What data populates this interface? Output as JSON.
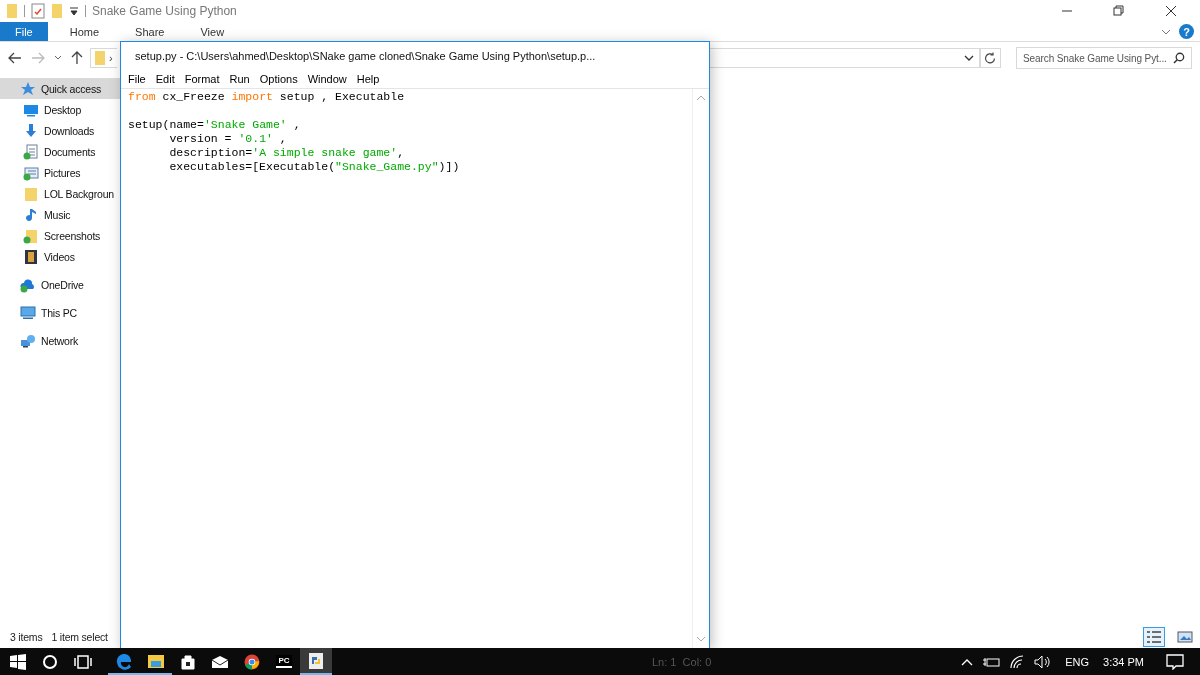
{
  "explorer": {
    "title": "Snake Game Using Python",
    "ribbon_tabs": [
      {
        "label": "File",
        "selected": true
      },
      {
        "label": "Home",
        "selected": false
      },
      {
        "label": "Share",
        "selected": false
      },
      {
        "label": "View",
        "selected": false
      }
    ],
    "help": "?",
    "address_chevron": "›",
    "search": {
      "placeholder": "Search Snake Game Using Pyt..."
    },
    "nav_items": [
      {
        "label": "Quick access",
        "kind": "star",
        "selected": true,
        "children": [
          {
            "label": "Desktop",
            "kind": "desktop",
            "selected": false
          },
          {
            "label": "Downloads",
            "kind": "download",
            "selected": false
          },
          {
            "label": "Documents",
            "kind": "documents",
            "selected": false
          },
          {
            "label": "Pictures",
            "kind": "pictures",
            "selected": false
          },
          {
            "label": "LOL Backgroun",
            "kind": "folder",
            "selected": false
          },
          {
            "label": "Music",
            "kind": "music",
            "selected": false
          },
          {
            "label": "Screenshots",
            "kind": "folder-check",
            "selected": false
          },
          {
            "label": "Videos",
            "kind": "videos",
            "selected": false
          }
        ]
      },
      {
        "label": "OneDrive",
        "kind": "cloud",
        "selected": false
      },
      {
        "label": "This PC",
        "kind": "pc",
        "selected": false
      },
      {
        "label": "Network",
        "kind": "network",
        "selected": false
      }
    ],
    "status": [
      "3 items",
      "1 item select"
    ],
    "views": [
      {
        "kind": "details",
        "selected": true
      },
      {
        "kind": "large",
        "selected": false
      }
    ]
  },
  "editor": {
    "title": "setup.py - C:\\Users\\ahmed\\Desktop\\SNake game cloned\\Snake Game Using Python\\setup.p...",
    "menu": [
      "File",
      "Edit",
      "Format",
      "Run",
      "Options",
      "Window",
      "Help"
    ],
    "lines": [
      {
        "tokens": [
          {
            "kind": "keyword",
            "text": "from"
          },
          {
            "kind": "plain",
            "text": " cx_Freeze "
          },
          {
            "kind": "keyword",
            "text": "import"
          },
          {
            "kind": "plain",
            "text": " setup , Executable"
          }
        ]
      },
      {
        "kind": "blank"
      },
      {
        "tokens": [
          {
            "kind": "plain",
            "text": "setup(name="
          },
          {
            "kind": "string",
            "text": "'Snake Game'"
          },
          {
            "kind": "plain",
            "text": " ,"
          }
        ]
      },
      {
        "tokens": [
          {
            "kind": "plain",
            "text": "      version = "
          },
          {
            "kind": "string",
            "text": "'0.1'"
          },
          {
            "kind": "plain",
            "text": " ,"
          }
        ]
      },
      {
        "tokens": [
          {
            "kind": "plain",
            "text": "      description="
          },
          {
            "kind": "string",
            "text": "'A simple snake game'"
          },
          {
            "kind": "plain",
            "text": ","
          }
        ]
      },
      {
        "tokens": [
          {
            "kind": "plain",
            "text": "      executables=[Executable("
          },
          {
            "kind": "string",
            "text": "\"Snake_Game.py\""
          },
          {
            "kind": "plain",
            "text": ")])"
          }
        ]
      }
    ],
    "position": "Ln: 1  Col: 0"
  },
  "taskbar": {
    "apps": [
      {
        "kind": "edge",
        "running": true,
        "active": false
      },
      {
        "kind": "explorer",
        "running": true,
        "active": false
      },
      {
        "kind": "store",
        "running": false,
        "active": false
      },
      {
        "kind": "mail",
        "running": false,
        "active": false
      },
      {
        "kind": "chrome",
        "running": false,
        "active": false
      },
      {
        "kind": "pycharm",
        "text": "PC",
        "running": false,
        "active": false
      },
      {
        "kind": "python",
        "running": true,
        "active": true
      }
    ],
    "language": "ENG",
    "time": "3:34 PM"
  }
}
